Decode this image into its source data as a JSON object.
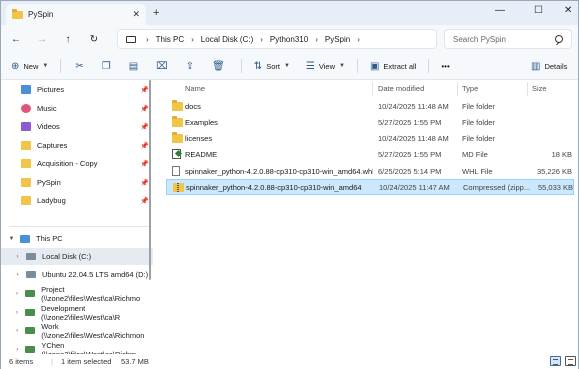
{
  "window": {
    "tab_title": "PySpin",
    "tab_close": "✕",
    "new_tab": "+",
    "minimize": "—",
    "maximize": "☐",
    "close": "✕"
  },
  "nav": {
    "back": "←",
    "forward": "→",
    "up": "↑",
    "refresh": "↻",
    "breadcrumbs": [
      "This PC",
      "Local Disk (C:)",
      "Python310",
      "PySpin"
    ],
    "separator": "›",
    "search_placeholder": "Search PySpin"
  },
  "commands": {
    "new": "New",
    "sort": "Sort",
    "view": "View",
    "extract_all": "Extract all",
    "more": "•••",
    "details": "Details"
  },
  "sidebar": {
    "quick_access": [
      {
        "label": "Pictures",
        "color": "#4a8fd8"
      },
      {
        "label": "Music",
        "color": "#e0567a"
      },
      {
        "label": "Videos",
        "color": "#8e5bd0"
      },
      {
        "label": "Captures",
        "color": "#f2c54a"
      },
      {
        "label": "Acquisition - Copy",
        "color": "#f2c54a"
      },
      {
        "label": "PySpin",
        "color": "#f2c54a"
      },
      {
        "label": "Ladybug",
        "color": "#f2c54a"
      }
    ],
    "this_pc": "This PC",
    "drives": [
      {
        "label": "Local Disk (C:)",
        "color": "#7a8d9f"
      },
      {
        "label": "Ubuntu 22.04.5 LTS amd64 (D:)",
        "color": "#7a8d9f"
      },
      {
        "label": "Project (\\\\zone2\\files\\West\\ca\\Richmo",
        "color": "#4c8c4a"
      },
      {
        "label": "Development (\\\\zone2\\files\\West\\ca\\R",
        "color": "#4c8c4a"
      },
      {
        "label": "Work (\\\\zone2\\files\\West\\ca\\Richmon",
        "color": "#4c8c4a"
      },
      {
        "label": "YChen (\\\\zone2\\files\\West\\ca\\Richm",
        "color": "#4c8c4a"
      }
    ]
  },
  "columns": {
    "name": "Name",
    "date": "Date modified",
    "type": "Type",
    "size": "Size"
  },
  "files": [
    {
      "name": "docs",
      "date": "10/24/2025 11:48 AM",
      "type": "File folder",
      "size": "",
      "icon": "folder-icon"
    },
    {
      "name": "Examples",
      "date": "5/27/2025 1:55 PM",
      "type": "File folder",
      "size": "",
      "icon": "folder-icon"
    },
    {
      "name": "licenses",
      "date": "10/24/2025 11:48 AM",
      "type": "File folder",
      "size": "",
      "icon": "folder-icon"
    },
    {
      "name": "README",
      "date": "5/27/2025 1:55 PM",
      "type": "MD File",
      "size": "18 KB",
      "icon": "markdown-file-icon"
    },
    {
      "name": "spinnaker_python-4.2.0.88-cp310-cp310-win_amd64.whl",
      "date": "6/25/2025 5:14 PM",
      "type": "WHL File",
      "size": "35,226 KB",
      "icon": "file-icon"
    },
    {
      "name": "spinnaker_python-4.2.0.88-cp310-cp310-win_amd64",
      "date": "10/24/2025 11:47 AM",
      "type": "Compressed (zipp...",
      "size": "55,033 KB",
      "icon": "zip-folder-icon"
    }
  ],
  "status": {
    "count": "6 items",
    "selection": "1 item selected",
    "selection_size": "53.7 MB"
  }
}
